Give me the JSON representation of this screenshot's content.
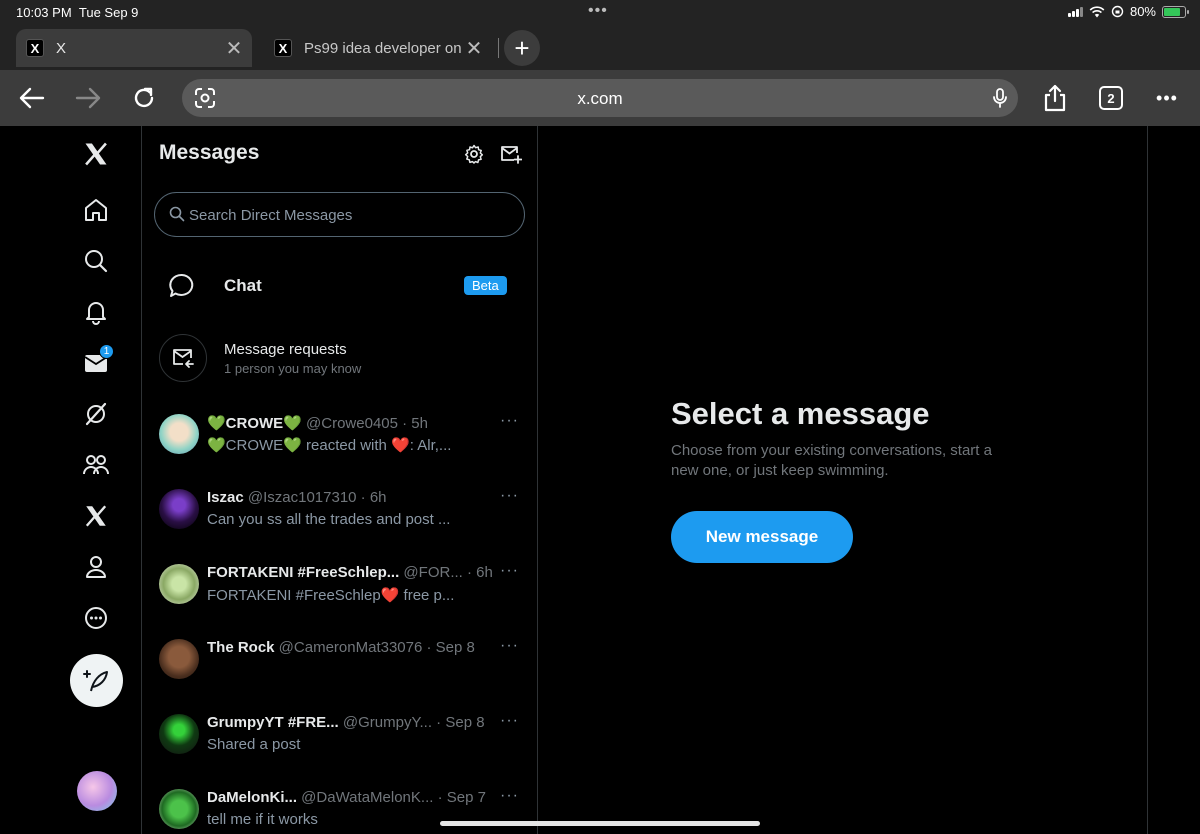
{
  "status_bar": {
    "time": "10:03 PM",
    "date": "Tue Sep 9",
    "dots": "•••",
    "battery": "80%"
  },
  "tabs": [
    {
      "favicon": "X",
      "title": "X",
      "close": "✕"
    },
    {
      "favicon": "X",
      "title": "Ps99 idea developer on",
      "close": "✕"
    }
  ],
  "new_tab": "+",
  "toolbar": {
    "url": "x.com",
    "tab_count": "2",
    "more": "•••"
  },
  "nav": {
    "notification_badge": "1"
  },
  "messages": {
    "title": "Messages",
    "search_placeholder": "Search Direct Messages",
    "chat_label": "Chat",
    "beta_label": "Beta",
    "requests_title": "Message requests",
    "requests_sub": "1 person you may know",
    "conversations": [
      {
        "name": "💚CROWE💚",
        "meta": " @Crowe0405 · 5h",
        "preview_a": "💚CROWE💚 reacted with ",
        "preview_heart": "❤️",
        "preview_b": ": Alr,...",
        "more": "···"
      },
      {
        "name": "Iszac",
        "meta": " @Iszac1017310 · 6h",
        "preview_a": "Can you ss all the trades and post ...",
        "preview_heart": "",
        "preview_b": "",
        "more": "···"
      },
      {
        "name": "FORTAKENI #FreeSchlep...",
        "meta": " @FOR... · 6h",
        "preview_a": "FORTAKENI #FreeSchlep",
        "preview_heart": "❤️",
        "preview_b": " free p...",
        "more": "···"
      },
      {
        "name": "The Rock",
        "meta": " @CameronMat33076 · Sep 8",
        "preview_a": "",
        "preview_heart": "",
        "preview_b": "",
        "more": "···"
      },
      {
        "name": "GrumpyYT #FRE...",
        "meta": " @GrumpyY... · Sep 8",
        "preview_a": "Shared a post",
        "preview_heart": "",
        "preview_b": "",
        "more": "···"
      },
      {
        "name": "DaMelonKi...",
        "meta": " @DaWataMelonK... · Sep 7",
        "preview_a": "tell me if it works",
        "preview_heart": "",
        "preview_b": "",
        "more": "···"
      }
    ]
  },
  "panel": {
    "title": "Select a message",
    "description": "Choose from your existing conversations, start a new one, or just keep swimming.",
    "button": "New message"
  },
  "colors": {
    "accent": "#1d9bf0",
    "background": "#000000",
    "border": "#2f3336",
    "muted": "#71767b"
  }
}
